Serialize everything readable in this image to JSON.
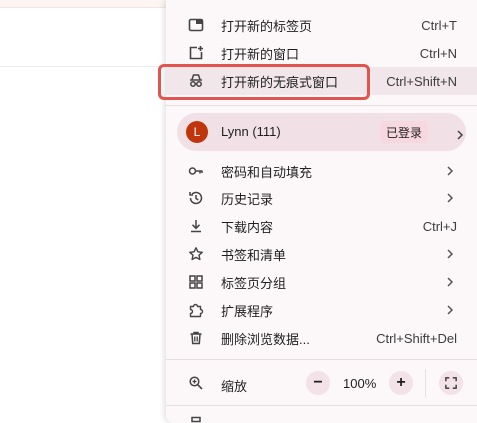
{
  "menu": {
    "new_tab": {
      "label": "打开新的标签页",
      "shortcut": "Ctrl+T",
      "icon": "new-tab-icon"
    },
    "new_window": {
      "label": "打开新的窗口",
      "shortcut": "Ctrl+N",
      "icon": "new-window-icon"
    },
    "incognito": {
      "label": "打开新的无痕式窗口",
      "shortcut": "Ctrl+Shift+N",
      "icon": "incognito-icon"
    },
    "profile": {
      "avatar_letter": "L",
      "name": "Lynn (111)",
      "status": "已登录",
      "avatar_color": "#bf360c"
    },
    "passwords": {
      "label": "密码和自动填充",
      "icon": "key-icon"
    },
    "history": {
      "label": "历史记录",
      "icon": "history-icon"
    },
    "downloads": {
      "label": "下载内容",
      "shortcut": "Ctrl+J",
      "icon": "download-icon"
    },
    "bookmarks": {
      "label": "书签和清单",
      "icon": "star-icon"
    },
    "tab_groups": {
      "label": "标签页分组",
      "icon": "grid-icon"
    },
    "extensions": {
      "label": "扩展程序",
      "icon": "puzzle-icon"
    },
    "clear_data": {
      "label": "删除浏览数据...",
      "shortcut": "Ctrl+Shift+Del",
      "icon": "trash-icon"
    },
    "zoom": {
      "label": "缩放",
      "value": "100%",
      "minus": "−",
      "plus": "+",
      "icon": "zoom-icon"
    }
  },
  "colors": {
    "menu_bg": "#fcf7f8",
    "highlight": "#f1e6e9",
    "annotation_box": "#e2554e",
    "profile_bg": "#f1e1e6",
    "badge_bg": "#f7d8e0"
  }
}
